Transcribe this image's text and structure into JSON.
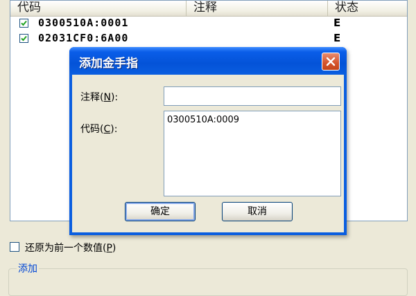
{
  "list": {
    "columns": [
      "代码",
      "注释",
      "状态"
    ],
    "rows": [
      {
        "checked": true,
        "code": "0300510A:0001",
        "note": "",
        "status": "E"
      },
      {
        "checked": true,
        "code": "02031CF0:6A00",
        "note": "",
        "status": "E"
      }
    ]
  },
  "dialog": {
    "title": "添加金手指",
    "note_label_prefix": "注释(",
    "note_label_key": "N",
    "note_label_suffix": "):",
    "note_value": "",
    "code_label_prefix": "代码(",
    "code_label_key": "C",
    "code_label_suffix": "):",
    "code_value": "0300510A:0009",
    "ok_label": "确定",
    "cancel_label": "取消"
  },
  "restore": {
    "checked": false,
    "label_prefix": "还原为前一个数值(",
    "label_key": "P",
    "label_suffix": ")"
  },
  "group": {
    "label": "添加"
  },
  "colors": {
    "titlebar": "#0a5ee0",
    "close_button": "#d5532c",
    "checkmark": "#21a121"
  }
}
